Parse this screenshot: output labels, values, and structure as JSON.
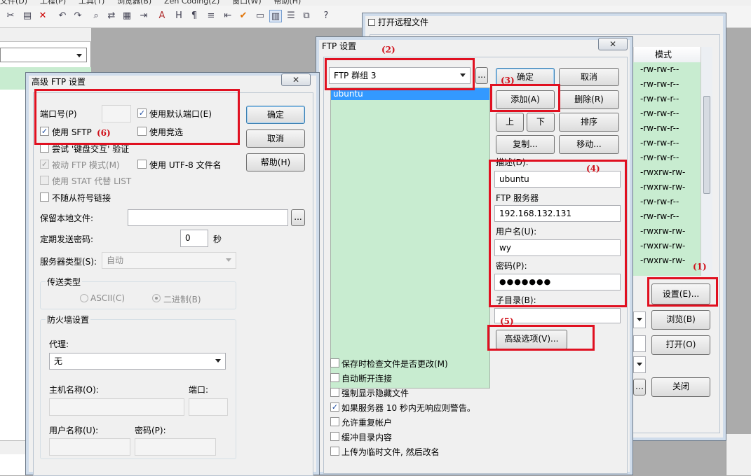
{
  "menubar": [
    "文件(D)",
    "工程(P)",
    "工具(T)",
    "浏览器(B)",
    "Zen Coding(Z)",
    "窗口(W)",
    "帮助(H)"
  ],
  "remote_window": {
    "title": "打开远程文件",
    "mode_header": "模式",
    "modes": [
      "-rw-rw-r--",
      "-rw-rw-r--",
      "-rw-rw-r--",
      "-rw-rw-r--",
      "-rw-rw-r--",
      "-rw-rw-r--",
      "-rw-rw-r--",
      "-rwxrw-rw-",
      "-rwxrw-rw-",
      "-rw-rw-r--",
      "-rw-rw-r--",
      "-rwxrw-rw-",
      "-rwxrw-rw-",
      "-rwxrw-rw-"
    ],
    "settings_btn": "设置(E)...",
    "browse_btn": "浏览(B)",
    "open_btn": "打开(O)",
    "close_btn": "关闭"
  },
  "ftp_window": {
    "title": "FTP 设置",
    "close_x": "✕",
    "group_select": "FTP 群组 3",
    "more": "...",
    "server_list": [
      "ubuntu"
    ],
    "ok": "确定",
    "cancel": "取消",
    "add": "添加(A)",
    "delete": "删除(R)",
    "up": "上",
    "down": "下",
    "sort": "排序",
    "copy": "复制...",
    "move": "移动...",
    "desc_label": "描述(D):",
    "desc_value": "ubuntu",
    "server_label": "FTP 服务器",
    "server_value": "192.168.132.131",
    "user_label": "用户名(U):",
    "user_value": "wy",
    "pass_label": "密码(P):",
    "pass_value": "●●●●●●●",
    "subdir_label": "子目录(B):",
    "subdir_value": "",
    "advanced": "高级选项(V)...",
    "checks": [
      {
        "label": "保存时检查文件是否更改(M)",
        "checked": false
      },
      {
        "label": "自动断开连接",
        "checked": false
      },
      {
        "label": "强制显示隐藏文件",
        "checked": false
      },
      {
        "label": "如果服务器 10 秒内无响应则警告。",
        "checked": true
      },
      {
        "label": "允许重复帐户",
        "checked": false
      },
      {
        "label": "缓冲目录内容",
        "checked": false
      },
      {
        "label": "上传为临时文件, 然后改名",
        "checked": false
      }
    ]
  },
  "adv_window": {
    "title": "高级 FTP 设置",
    "close_x": "✕",
    "port_label": "端口号(P)",
    "port_value": "",
    "use_default_port": "使用默认端口(E)",
    "use_sftp": "使用 SFTP",
    "use_race": "使用竞选",
    "try_keyboard": "尝试 '键盘交互' 验证",
    "passive": "被动 FTP 模式(M)",
    "use_utf8": "使用 UTF-8 文件名",
    "use_stat": "使用 STAT 代替 LIST",
    "no_symlink": "不随从符号链接",
    "keep_local_label": "保留本地文件:",
    "keep_local_value": "",
    "keep_local_more": "...",
    "send_pw_label": "定期发送密码:",
    "send_pw_value": "0",
    "send_pw_unit": "秒",
    "server_type_label": "服务器类型(S):",
    "server_type_value": "自动",
    "transfer_group": "传送类型",
    "ascii": "ASCII(C)",
    "binary": "二进制(B)",
    "firewall_group": "防火墙设置",
    "proxy_label": "代理:",
    "proxy_value": "无",
    "host_label": "主机名称(O):",
    "port2_label": "端口:",
    "fw_user_label": "用户名称(U):",
    "fw_pass_label": "密码(P):",
    "ok": "确定",
    "cancel": "取消",
    "help": "帮助(H)"
  },
  "annotations": {
    "a1": "(1)",
    "a2": "(2)",
    "a3": "(3)",
    "a4": "(4)",
    "a5": "(5)",
    "a6": "(6)"
  },
  "colors": {
    "highlight_red": "#e01020",
    "list_green": "#c8ecd0",
    "selection_blue": "#3399ff"
  }
}
